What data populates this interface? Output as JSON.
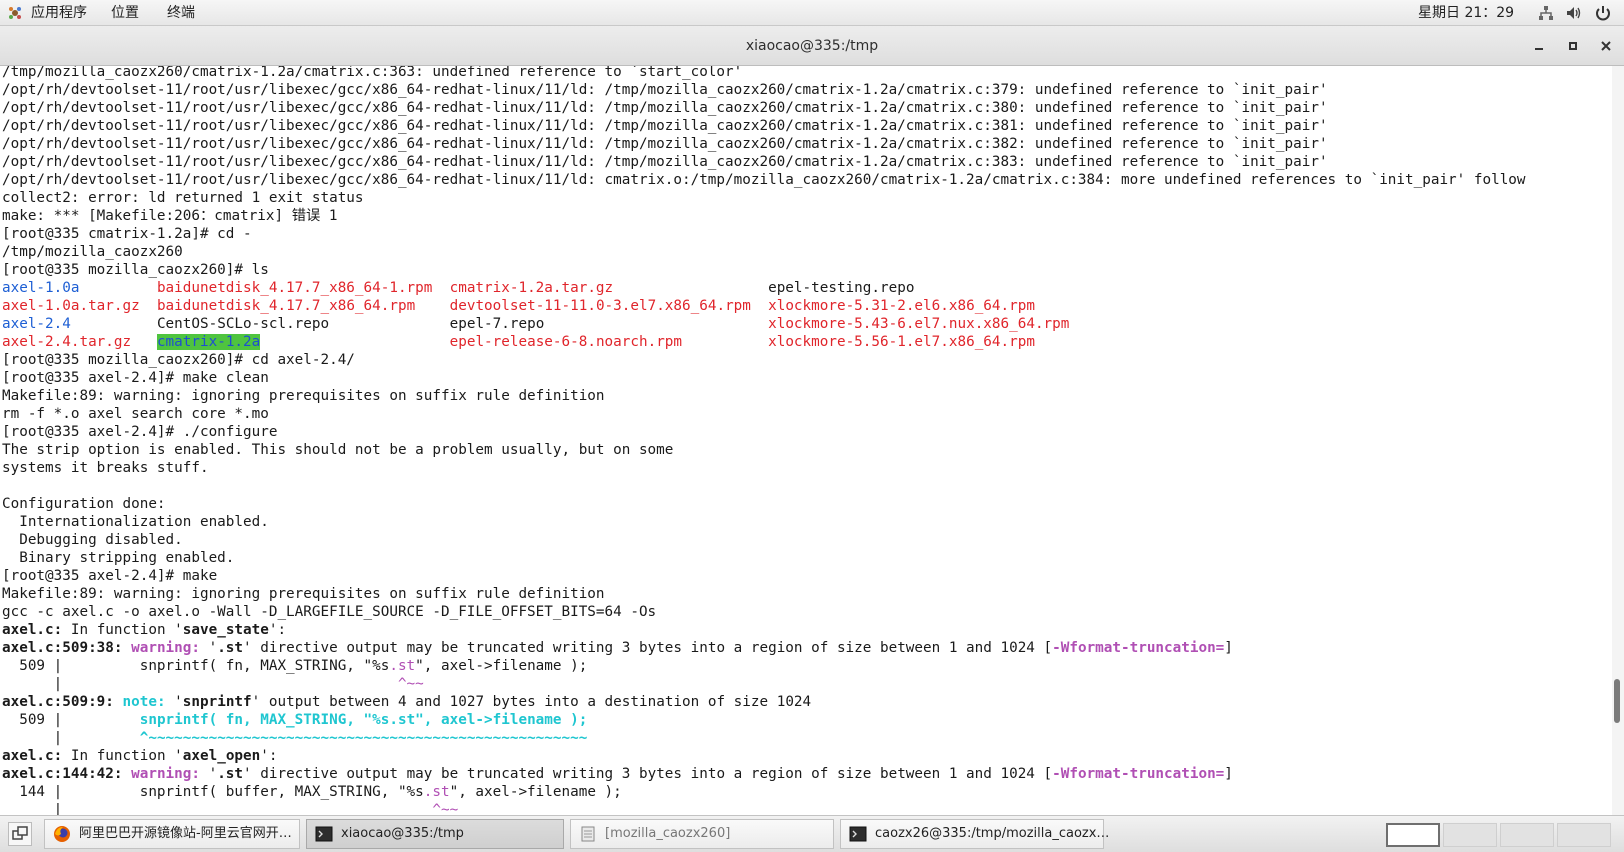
{
  "top_panel": {
    "menus": [
      "应用程序",
      "位置",
      "终端"
    ],
    "clock": "星期日 21：29",
    "tray_icons": [
      "network-icon",
      "volume-icon",
      "power-icon"
    ]
  },
  "window": {
    "title": "xiaocao@335:/tmp",
    "buttons": [
      "minimize",
      "maximize",
      "close"
    ]
  },
  "terminal": {
    "lines": [
      [
        {
          "t": "/tmp/mozilla_caozx260/cmatrix-1.2a/cmatrix.c:363: undefined reference to `start_color'"
        }
      ],
      [
        {
          "t": "/opt/rh/devtoolset-11/root/usr/libexec/gcc/x86_64-redhat-linux/11/ld: /tmp/mozilla_caozx260/cmatrix-1.2a/cmatrix.c:379: undefined reference to `init_pair'"
        }
      ],
      [
        {
          "t": "/opt/rh/devtoolset-11/root/usr/libexec/gcc/x86_64-redhat-linux/11/ld: /tmp/mozilla_caozx260/cmatrix-1.2a/cmatrix.c:380: undefined reference to `init_pair'"
        }
      ],
      [
        {
          "t": "/opt/rh/devtoolset-11/root/usr/libexec/gcc/x86_64-redhat-linux/11/ld: /tmp/mozilla_caozx260/cmatrix-1.2a/cmatrix.c:381: undefined reference to `init_pair'"
        }
      ],
      [
        {
          "t": "/opt/rh/devtoolset-11/root/usr/libexec/gcc/x86_64-redhat-linux/11/ld: /tmp/mozilla_caozx260/cmatrix-1.2a/cmatrix.c:382: undefined reference to `init_pair'"
        }
      ],
      [
        {
          "t": "/opt/rh/devtoolset-11/root/usr/libexec/gcc/x86_64-redhat-linux/11/ld: /tmp/mozilla_caozx260/cmatrix-1.2a/cmatrix.c:383: undefined reference to `init_pair'"
        }
      ],
      [
        {
          "t": "/opt/rh/devtoolset-11/root/usr/libexec/gcc/x86_64-redhat-linux/11/ld: cmatrix.o:/tmp/mozilla_caozx260/cmatrix-1.2a/cmatrix.c:384: more undefined references to `init_pair' follow"
        }
      ],
      [
        {
          "t": "collect2: error: ld returned 1 exit status"
        }
      ],
      [
        {
          "t": "make: *** [Makefile:206：cmatrix] 错误 1"
        }
      ],
      [
        {
          "t": "[root@335 cmatrix-1.2a]# cd -"
        }
      ],
      [
        {
          "t": "/tmp/mozilla_caozx260"
        }
      ],
      [
        {
          "t": "[root@335 mozilla_caozx260]# ls"
        }
      ],
      [
        {
          "t": "axel-1.0a",
          "c": "blue"
        },
        {
          "t": "         "
        },
        {
          "t": "baidunetdisk_4.17.7_x86_64-1.rpm",
          "c": "red"
        },
        {
          "t": "  "
        },
        {
          "t": "cmatrix-1.2a.tar.gz",
          "c": "red"
        },
        {
          "t": "                  "
        },
        {
          "t": "epel-testing.repo"
        }
      ],
      [
        {
          "t": "axel-1.0a.tar.gz",
          "c": "red"
        },
        {
          "t": "  "
        },
        {
          "t": "baidunetdisk_4.17.7_x86_64.rpm",
          "c": "red"
        },
        {
          "t": "    "
        },
        {
          "t": "devtoolset-11-11.0-3.el7.x86_64.rpm",
          "c": "red"
        },
        {
          "t": "  "
        },
        {
          "t": "xlockmore-5.31-2.el6.x86_64.rpm",
          "c": "red"
        }
      ],
      [
        {
          "t": "axel-2.4",
          "c": "blue"
        },
        {
          "t": "          "
        },
        {
          "t": "CentOS-SCLo-scl.repo"
        },
        {
          "t": "              "
        },
        {
          "t": "epel-7.repo"
        },
        {
          "t": "                          "
        },
        {
          "t": "xlockmore-5.43-6.el7.nux.x86_64.rpm",
          "c": "red"
        }
      ],
      [
        {
          "t": "axel-2.4.tar.gz",
          "c": "red"
        },
        {
          "t": "   "
        },
        {
          "t": "cmatrix-1.2a",
          "c": "hl"
        },
        {
          "t": "                      "
        },
        {
          "t": "epel-release-6-8.noarch.rpm",
          "c": "red"
        },
        {
          "t": "          "
        },
        {
          "t": "xlockmore-5.56-1.el7.x86_64.rpm",
          "c": "red"
        }
      ],
      [
        {
          "t": "[root@335 mozilla_caozx260]# cd axel-2.4/"
        }
      ],
      [
        {
          "t": "[root@335 axel-2.4]# make clean"
        }
      ],
      [
        {
          "t": "Makefile:89: warning: ignoring prerequisites on suffix rule definition"
        }
      ],
      [
        {
          "t": "rm -f *.o axel search core *.mo"
        }
      ],
      [
        {
          "t": "[root@335 axel-2.4]# ./configure"
        }
      ],
      [
        {
          "t": "The strip option is enabled. This should not be a problem usually, but on some"
        }
      ],
      [
        {
          "t": "systems it breaks stuff."
        }
      ],
      [
        {
          "t": ""
        }
      ],
      [
        {
          "t": "Configuration done:"
        }
      ],
      [
        {
          "t": "  Internationalization enabled."
        }
      ],
      [
        {
          "t": "  Debugging disabled."
        }
      ],
      [
        {
          "t": "  Binary stripping enabled."
        }
      ],
      [
        {
          "t": "[root@335 axel-2.4]# make"
        }
      ],
      [
        {
          "t": "Makefile:89: warning: ignoring prerequisites on suffix rule definition"
        }
      ],
      [
        {
          "t": "gcc -c axel.c -o axel.o -Wall -D_LARGEFILE_SOURCE -D_FILE_OFFSET_BITS=64 -Os"
        }
      ],
      [
        {
          "t": "axel.c:",
          "c": "bold"
        },
        {
          "t": " In function '"
        },
        {
          "t": "save_state",
          "c": "bold"
        },
        {
          "t": "':"
        }
      ],
      [
        {
          "t": "axel.c:509:38:",
          "c": "bold"
        },
        {
          "t": " "
        },
        {
          "t": "warning: ",
          "c": "purple"
        },
        {
          "t": "'"
        },
        {
          "t": ".st",
          "c": "bold"
        },
        {
          "t": "' directive output may be truncated writing 3 bytes into a region of size between 1 and 1024 ["
        },
        {
          "t": "-Wformat-truncation=",
          "c": "purple"
        },
        {
          "t": "]"
        }
      ],
      [
        {
          "t": "  509 |         snprintf( fn, MAX_STRING, \"%s"
        },
        {
          "t": ".st",
          "c": "mag"
        },
        {
          "t": "\", axel->filename );"
        }
      ],
      [
        {
          "t": "      |                                       "
        },
        {
          "t": "^~~",
          "c": "mag"
        }
      ],
      [
        {
          "t": "axel.c:509:9:",
          "c": "bold"
        },
        {
          "t": " "
        },
        {
          "t": "note: ",
          "c": "cyan"
        },
        {
          "t": "'"
        },
        {
          "t": "snprintf",
          "c": "bold"
        },
        {
          "t": "' output between 4 and 1027 bytes into a destination of size 1024"
        }
      ],
      [
        {
          "t": "  509 |         "
        },
        {
          "t": "snprintf( fn, MAX_STRING, \"%s.st\", axel->filename );",
          "c": "cyan"
        }
      ],
      [
        {
          "t": "      |         "
        },
        {
          "t": "^~~~~~~~~~~~~~~~~~~~~~~~~~~~~~~~~~~~~~~~~~~~~~~~~~~~",
          "c": "cyan"
        }
      ],
      [
        {
          "t": "axel.c:",
          "c": "bold"
        },
        {
          "t": " In function '"
        },
        {
          "t": "axel_open",
          "c": "bold"
        },
        {
          "t": "':"
        }
      ],
      [
        {
          "t": "axel.c:144:42:",
          "c": "bold"
        },
        {
          "t": " "
        },
        {
          "t": "warning: ",
          "c": "purple"
        },
        {
          "t": "'"
        },
        {
          "t": ".st",
          "c": "bold"
        },
        {
          "t": "' directive output may be truncated writing 3 bytes into a region of size between 1 and 1024 ["
        },
        {
          "t": "-Wformat-truncation=",
          "c": "purple"
        },
        {
          "t": "]"
        }
      ],
      [
        {
          "t": "  144 |         snprintf( buffer, MAX_STRING, \"%s"
        },
        {
          "t": ".st",
          "c": "mag"
        },
        {
          "t": "\", axel->filename );"
        }
      ],
      [
        {
          "t": "      |                                           "
        },
        {
          "t": "^~~",
          "c": "mag"
        }
      ]
    ]
  },
  "taskbar": {
    "tasks": [
      {
        "label": "阿里巴巴开源镜像站-阿里云官网开…",
        "icon": "firefox-icon",
        "active": false
      },
      {
        "label": "xiaocao@335:/tmp",
        "icon": "terminal-icon",
        "active": true
      },
      {
        "label": "[mozilla_caozx260]",
        "icon": "file-manager-icon",
        "active": false
      },
      {
        "label": "caozx26@335:/tmp/mozilla_caozx…",
        "icon": "terminal-icon",
        "active": false
      }
    ],
    "workspaces": 4,
    "active_workspace": 1
  },
  "colors": {
    "prompt_text": "#1a1a1a",
    "archive_red": "#e0252b",
    "directory_blue": "#1e5fd4",
    "highlight_green": "#4fc43f",
    "warning_purple": "#b04fb4",
    "note_cyan": "#1fc6d0"
  }
}
